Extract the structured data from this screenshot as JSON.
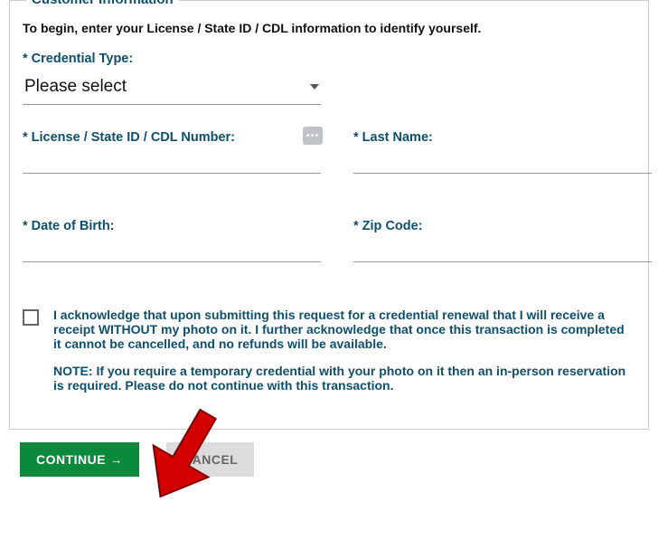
{
  "legend": "Customer Information",
  "intro": "To begin, enter your License / State ID / CDL information to identify yourself.",
  "labels": {
    "cred_type": "* Credential Type:",
    "license_num": "* License / State ID / CDL Number:",
    "last_name": "* Last Name:",
    "dob": "* Date of Birth:",
    "zip": "* Zip Code:"
  },
  "select": {
    "value": "Please select"
  },
  "ack": {
    "p1_pre": "I acknowledge that upon submitting this request for a credential renewal that I will receive a receipt ",
    "p1_bold": "WITHOUT",
    "p1_post": " my photo on it. I further acknowledge that once this transaction is completed it cannot be cancelled, and no refunds will be available.",
    "p2_bold": "NOTE:",
    "p2_post": " If you require a temporary credential with your photo on it then an in-person reservation is required. Please do not continue with this transaction."
  },
  "buttons": {
    "continue": "CONTINUE →",
    "cancel": "CANCEL"
  }
}
